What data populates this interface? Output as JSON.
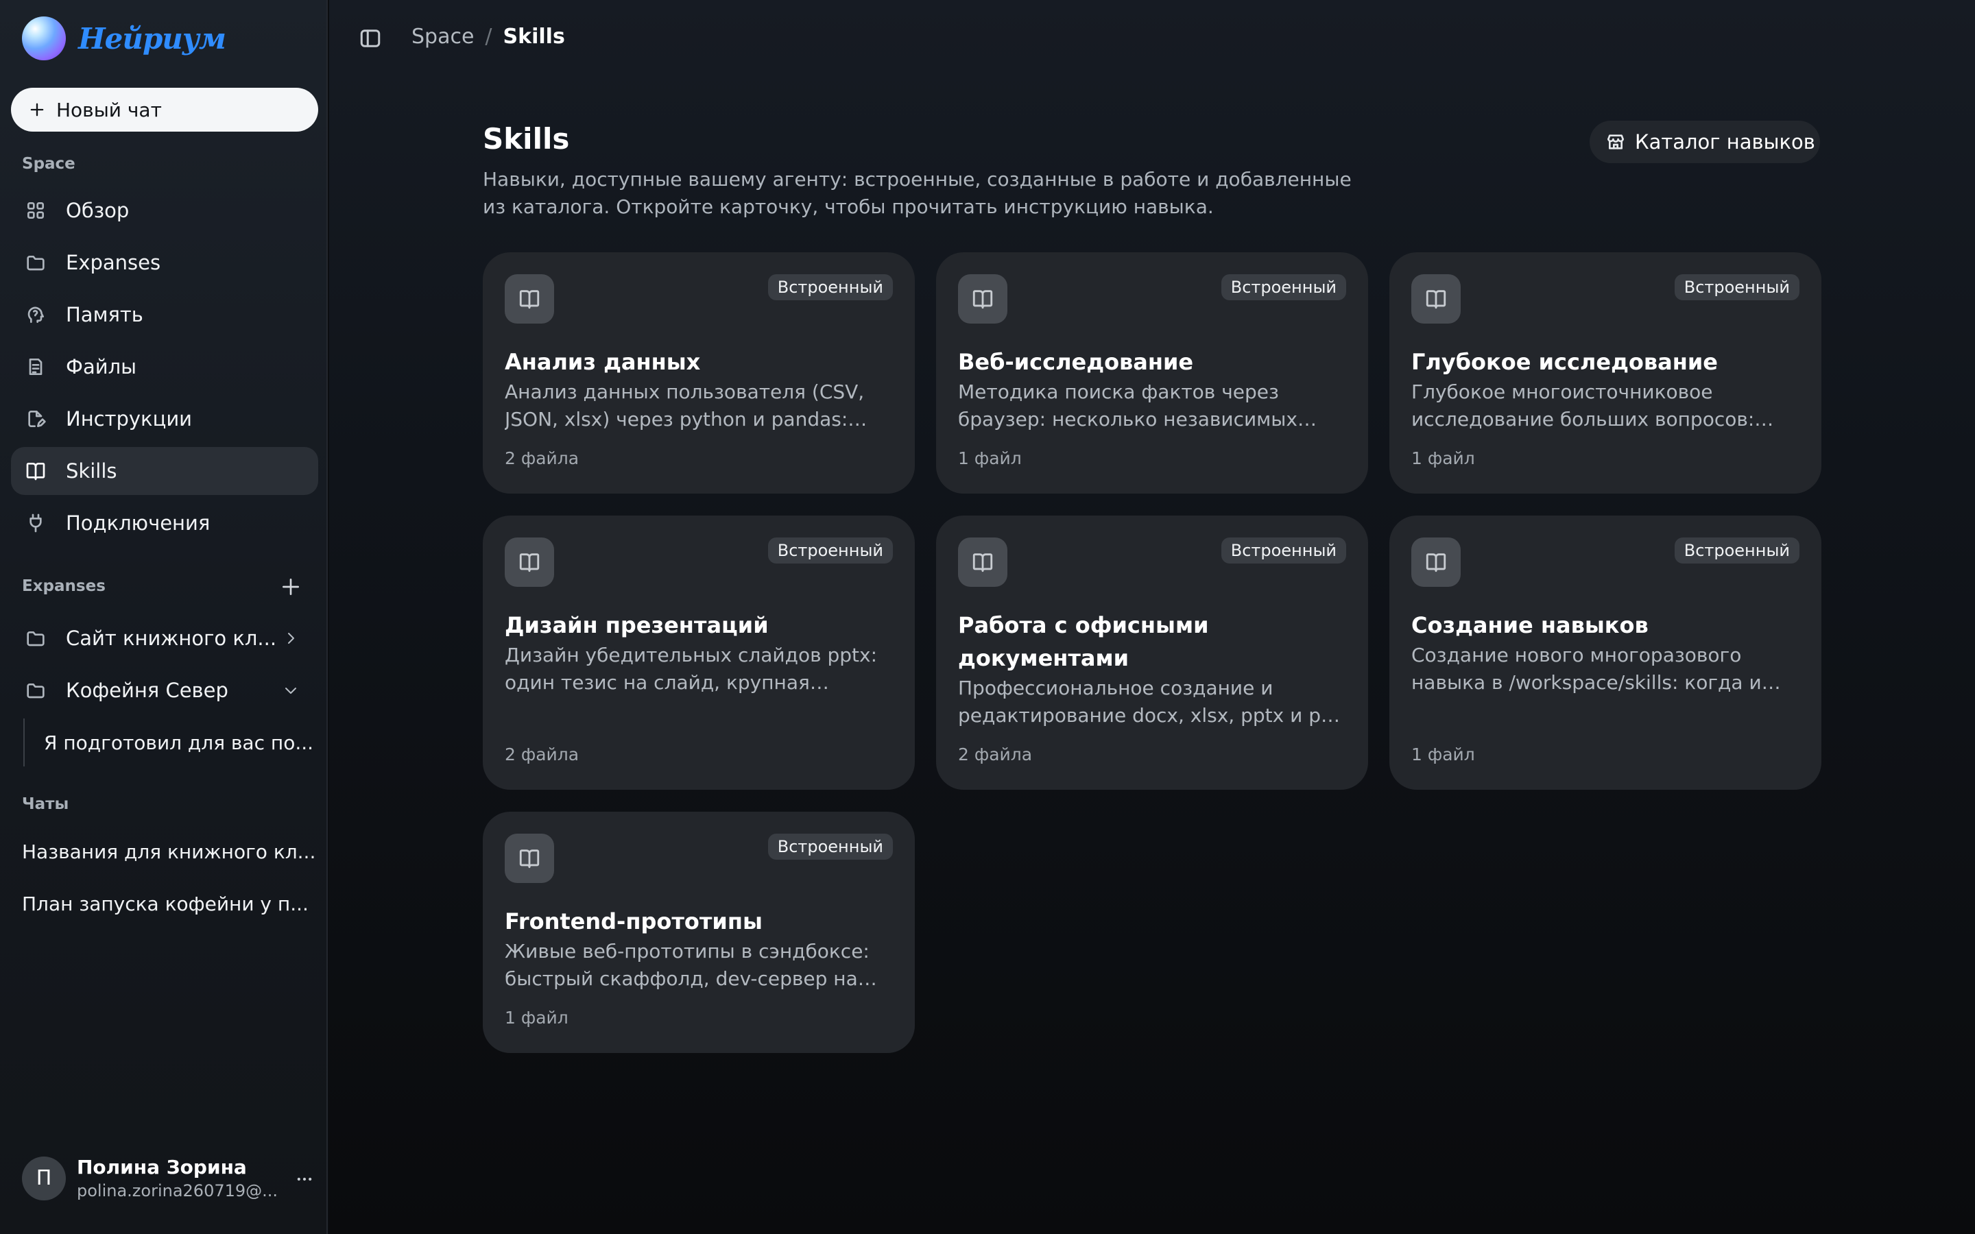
{
  "app": {
    "logo_text": "Нейриум"
  },
  "sidebar": {
    "new_chat_label": "Новый чат",
    "space_label": "Space",
    "nav": [
      {
        "label": "Обзор",
        "icon": "grid-icon"
      },
      {
        "label": "Expanses",
        "icon": "folder-icon"
      },
      {
        "label": "Память",
        "icon": "brain-icon"
      },
      {
        "label": "Файлы",
        "icon": "file-icon"
      },
      {
        "label": "Инструкции",
        "icon": "edit-file-icon"
      },
      {
        "label": "Skills",
        "icon": "book-icon",
        "active": true
      },
      {
        "label": "Подключения",
        "icon": "plug-icon"
      }
    ],
    "expanses_label": "Expanses",
    "expanses": [
      {
        "label": "Сайт книжного кл...",
        "icon": "folder-icon",
        "chevron": "chevron-right-icon"
      },
      {
        "label": "Кофейня Север",
        "icon": "folder-icon",
        "chevron": "chevron-down-icon"
      }
    ],
    "expanse_thread": "Я подготовил для вас по...",
    "chats_label": "Чаты",
    "chats": [
      {
        "label": "Названия для книжного кл..."
      },
      {
        "label": "План запуска кофейни у п..."
      }
    ],
    "user": {
      "initial": "П",
      "name": "Полина Зорина",
      "email": "polina.zorina260719@..."
    }
  },
  "header": {
    "breadcrumb": [
      "Space",
      "Skills"
    ],
    "separator": "/"
  },
  "page": {
    "title": "Skills",
    "description": "Навыки, доступные вашему агенту: встроенные, созданные в работе и добавленные из каталога. Откройте карточку, чтобы прочитать инструкцию навыка.",
    "catalog_button": "Каталог навыков"
  },
  "skills": [
    {
      "title": "Анализ данных",
      "tag": "Встроенный",
      "description": "Анализ данных пользователя (CSV, JSON, xlsx) через python и pandas: загрузка, очистка и визуализация",
      "files": "2 файла"
    },
    {
      "title": "Веб-исследование",
      "tag": "Встроенный",
      "description": "Методика поиска фактов через браузер: несколько независимых источников и проверка",
      "files": "1 файл"
    },
    {
      "title": "Глубокое исследование",
      "tag": "Встроенный",
      "description": "Глубокое многоисточниковое исследование больших вопросов: план, поиск и отчёт",
      "files": "1 файл"
    },
    {
      "title": "Дизайн презентаций",
      "tag": "Встроенный",
      "description": "Дизайн убедительных слайдов pptx: один тезис на слайд, крупная типографика",
      "files": "2 файла"
    },
    {
      "title": "Работа с офисными документами",
      "tag": "Встроенный",
      "description": "Профессиональное создание и редактирование docx, xlsx, pptx и pdf файлов",
      "files": "2 файла"
    },
    {
      "title": "Создание навыков",
      "tag": "Встроенный",
      "description": "Создание нового многоразового навыка в /workspace/skills: когда и как оформлять",
      "files": "1 файл"
    },
    {
      "title": "Frontend-прототипы",
      "tag": "Встроенный",
      "description": "Живые веб-прототипы в сэндбоксе: быстрый скаффолд, dev-сервер на порту",
      "files": "1 файл"
    }
  ]
}
